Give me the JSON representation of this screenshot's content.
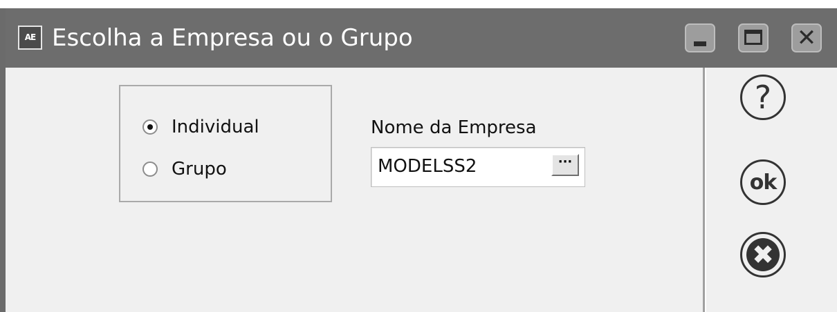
{
  "window": {
    "icon_label": "AE",
    "title": "Escolha a Empresa ou o Grupo",
    "controls": {
      "minimize_glyph": "_",
      "close_glyph": "✕"
    }
  },
  "selection": {
    "options": [
      {
        "label": "Individual",
        "checked": true
      },
      {
        "label": "Grupo",
        "checked": false
      }
    ]
  },
  "company": {
    "label": "Nome da Empresa",
    "value": "MODELSS2",
    "browse_label": "···"
  },
  "sidebar": {
    "help_glyph": "?",
    "ok_label": "ok",
    "cancel_glyph": "✖"
  },
  "icons": [
    "app-icon",
    "minimize-icon",
    "maximize-icon",
    "close-icon",
    "help-icon",
    "ok-icon",
    "cancel-icon"
  ]
}
